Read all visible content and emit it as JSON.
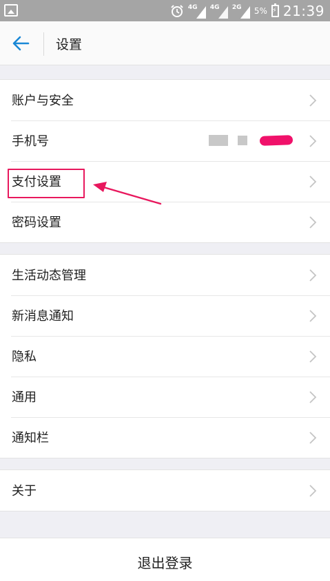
{
  "status_bar": {
    "network_1": "4G",
    "network_2": "4G",
    "network_3": "2G",
    "battery_percent": "5%",
    "time": "21:39"
  },
  "header": {
    "title": "设置"
  },
  "groups": [
    {
      "items": [
        {
          "label": "账户与安全"
        },
        {
          "label": "手机号"
        },
        {
          "label": "支付设置"
        },
        {
          "label": "密码设置"
        }
      ]
    },
    {
      "items": [
        {
          "label": "生活动态管理"
        },
        {
          "label": "新消息通知"
        },
        {
          "label": "隐私"
        },
        {
          "label": "通用"
        },
        {
          "label": "通知栏"
        }
      ]
    },
    {
      "items": [
        {
          "label": "关于"
        }
      ]
    }
  ],
  "logout": {
    "label": "退出登录"
  },
  "colors": {
    "accent": "#1a88d6",
    "annotation": "#e8175d",
    "status_bar": "#a5a5a5",
    "background": "#efeff4"
  }
}
